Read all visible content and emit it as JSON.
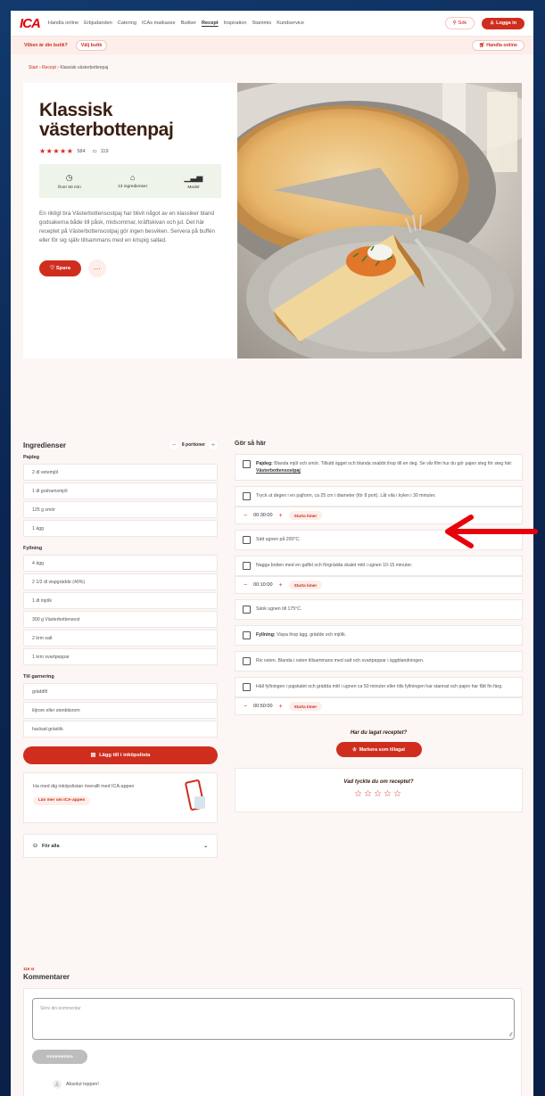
{
  "header": {
    "logo": "ICA",
    "nav": [
      "Handla online",
      "Erbjudanden",
      "Catering",
      "ICAs matkasse",
      "Butiker",
      "Recept",
      "Inspiration",
      "Stammis",
      "Kundservice"
    ],
    "active_nav": "Recept",
    "search_label": "Sök",
    "login_label": "Logga in"
  },
  "subnav": {
    "question": "Vilken är din butik?",
    "choose_store": "Välj butik",
    "shop_online": "Handla online"
  },
  "breadcrumb": [
    "Start",
    "Recept",
    "Klassisk västerbottenpaj"
  ],
  "recipe": {
    "title_line1": "Klassisk",
    "title_line2": "västerbottenpaj",
    "stars": "★★★★★",
    "rating_count": "584",
    "comment_count": "119",
    "time": "Över 60 min",
    "ingredients_count": "13 ingredienser",
    "difficulty": "Medel",
    "description": "En riktigt bra Västerbottensostpaj har blivit något av en klassiker bland godsakerna både till påsk, midsommar, kräftskivan och jul. Det här receptet på Västerbottensostpaj gör ingen besviken. Servera på buffén eller för sig själv tillsammans med en krispig sallad.",
    "save_label": "Spara",
    "more_label": "···"
  },
  "ingredients": {
    "heading": "Ingredienser",
    "portions": "8 portioner",
    "groups": [
      {
        "name": "Pajdeg",
        "items": [
          "2 dl vetemjöl",
          "1 dl grahamsmjöl",
          "125 g smör",
          "1 ägg"
        ]
      },
      {
        "name": "Fyllning",
        "items": [
          "4 ägg",
          "2 1/2 dl vispgrädde (40%)",
          "1 dl mjölk",
          "300 g Västerbottensost",
          "2 krm salt",
          "1 krm svartpeppar"
        ]
      },
      {
        "name": "Till garnering",
        "items": [
          "gräddfil",
          "löjrom eller stenbitsrom",
          "hackad gräslök"
        ]
      }
    ],
    "add_to_list": "Lägg till i inköpslista",
    "app_text": "Ha med dig inköpslistan överallt med ICA-appen",
    "app_button": "Läs mer om ICA-appen",
    "for_all": "För alla"
  },
  "steps": {
    "heading": "Gör så här",
    "step1_bold": "Pajdeg:",
    "step1_text": "Blanda mjöl och smör. Tillsätt ägget och blanda snabbt ihop till en deg. Se vår film hur du gör pajen steg för steg här:",
    "step1_link": "Västerbottensostpaj",
    "step2": "Tryck ut degen i en pajform, ca 25 cm i diameter (för 8 port). Låt vila i kylen i 30 minuter.",
    "timer1": "00:30:00",
    "step3": "Sätt ugnen på 200°C.",
    "step4": "Nagga botten med en gaffel och förgrädda skalet mitt i ugnen 10-15 minuter.",
    "timer2": "00:10:00",
    "step5": "Sänk ugnen till 175°C.",
    "step6_bold": "Fyllning:",
    "step6_text": "Vispa ihop ägg, grädde och mjölk.",
    "step7": "Riv osten. Blanda i osten tillsammans med salt och svartpeppar i äggblandningen.",
    "step8": "Häll fyllningen i pajskalet och grädda mitt i ugnen ca 50 minuter eller tills fyllningen har stannat och pajen har fått fin färg.",
    "timer3": "00:50:00",
    "start_timer": "Starta timer",
    "minus": "−",
    "plus": "+",
    "made_question": "Har du lagat receptet?",
    "mark_made": "Markera som tillagat",
    "rate_question": "Vad tyckte du om receptet?",
    "rate_stars": "☆☆☆☆☆"
  },
  "comments": {
    "count": "119 st",
    "heading": "Kommentarer",
    "placeholder": "Skriv din kommentar",
    "submit": "Kommentera",
    "report": "Absolut toppen!"
  },
  "colors": {
    "brand": "#cf2e1f",
    "accent_bg": "#fdeeea",
    "arrow": "#e8000b"
  }
}
